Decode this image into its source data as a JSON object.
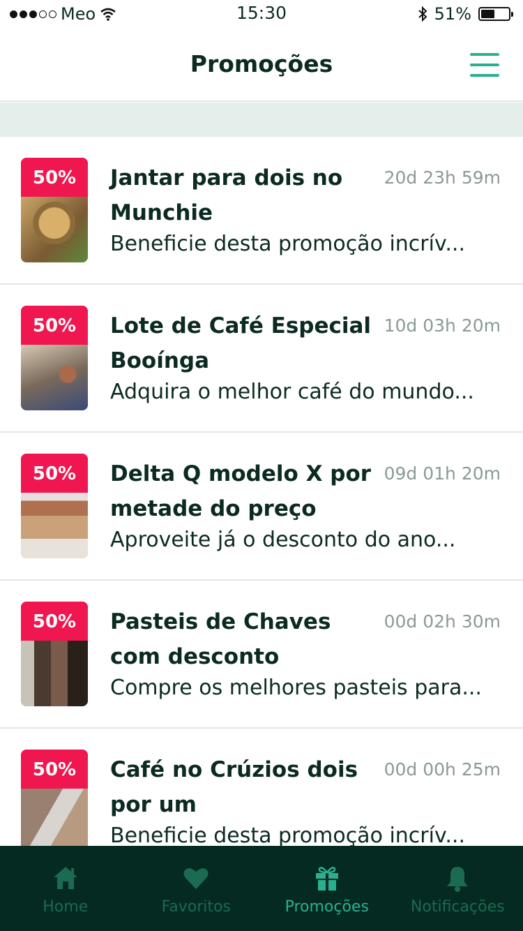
{
  "status_bar": {
    "carrier": "Meo",
    "time": "15:30",
    "battery": "51%",
    "battery_level": 0.51
  },
  "header": {
    "title": "Promoções",
    "menu_icon": "hamburger-menu-icon"
  },
  "colors": {
    "accent": "#2ab08f",
    "badge": "#f0164f",
    "tab_bar_bg": "#052a21",
    "strip": "#e4efec"
  },
  "promotions": [
    {
      "badge": "50%",
      "title": "Jantar para dois no Munchie",
      "time_left": "20d 23h 59m",
      "description": "Beneficie desta promoção incrív..."
    },
    {
      "badge": "50%",
      "title": "Lote de Café Especial Booínga",
      "time_left": "10d 03h 20m",
      "description": "Adquira o melhor café do mundo..."
    },
    {
      "badge": "50%",
      "title": "Delta Q modelo X por metade do preço",
      "time_left": "09d 01h 20m",
      "description": "Aproveite já o desconto do ano..."
    },
    {
      "badge": "50%",
      "title": "Pasteis de Chaves com desconto",
      "time_left": "00d 02h 30m",
      "description": "Compre os melhores pasteis para..."
    },
    {
      "badge": "50%",
      "title": "Café no Crúzios  dois por um",
      "time_left": "00d 00h 25m",
      "description": "Beneficie desta promoção incrív..."
    }
  ],
  "tabs": [
    {
      "label": "Home",
      "icon": "home-icon",
      "active": false
    },
    {
      "label": "Favoritos",
      "icon": "heart-icon",
      "active": false
    },
    {
      "label": "Promoções",
      "icon": "gift-icon",
      "active": true
    },
    {
      "label": "Notificações",
      "icon": "bell-icon",
      "active": false
    }
  ]
}
